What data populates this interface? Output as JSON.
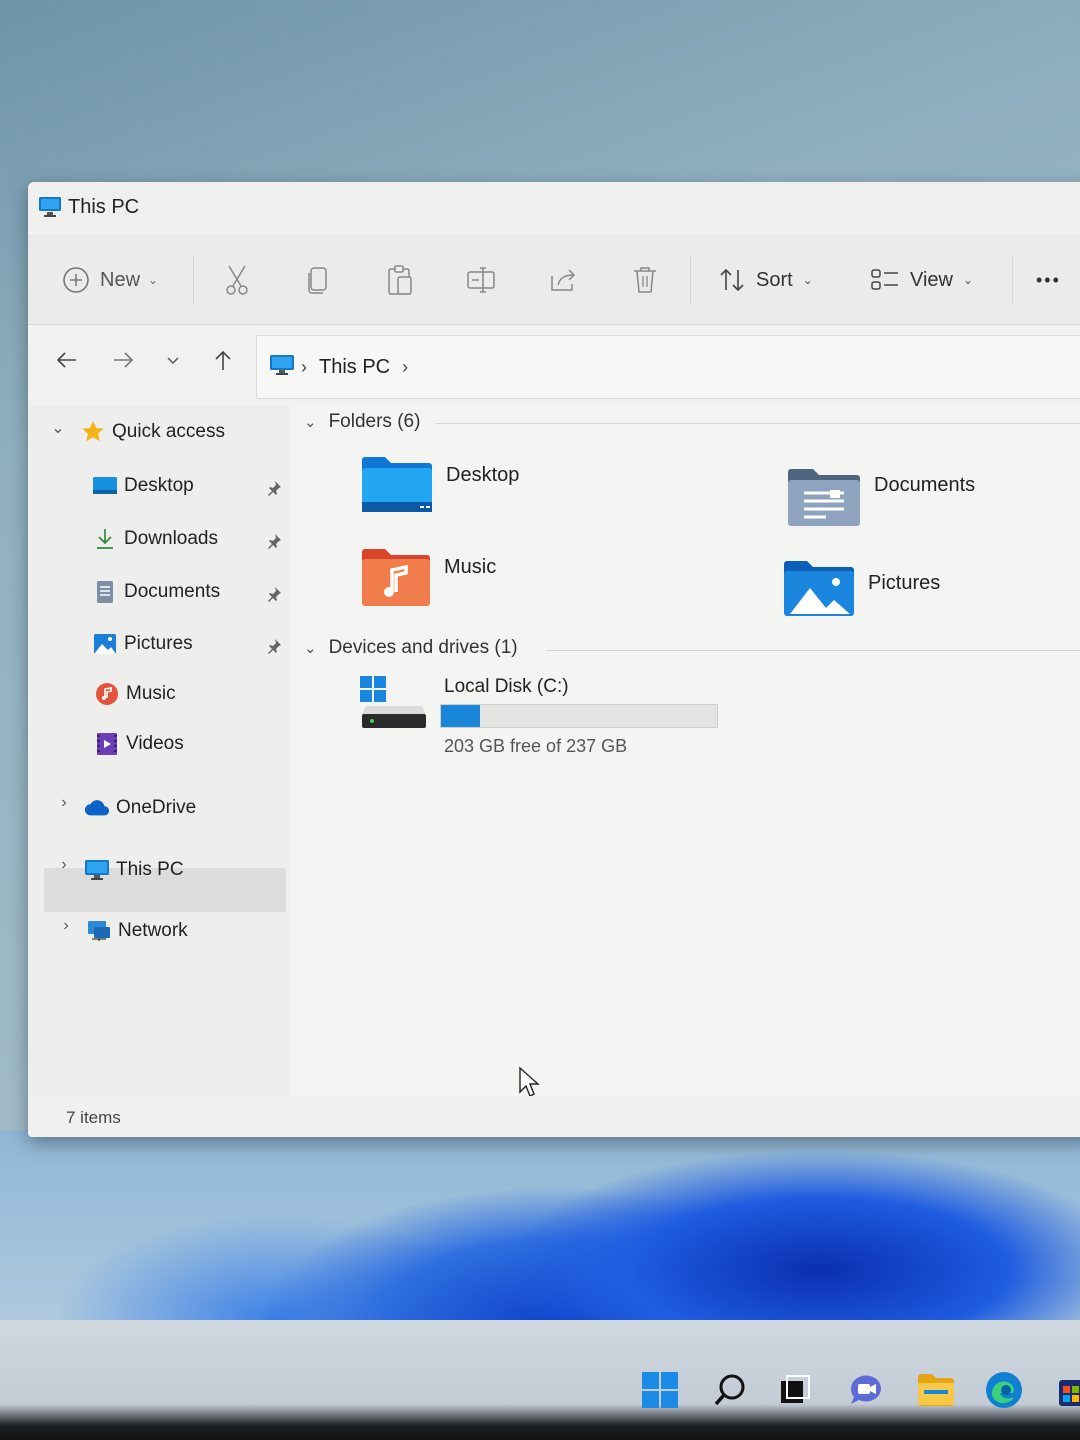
{
  "window": {
    "title": "This PC"
  },
  "toolbar": {
    "new_label": "New",
    "sort_label": "Sort",
    "view_label": "View",
    "more_label": "•••"
  },
  "address": {
    "location": "This PC"
  },
  "sidebar": {
    "quick_access": "Quick access",
    "items": [
      {
        "label": "Desktop",
        "icon": "desktop-folder-icon",
        "pinned": true
      },
      {
        "label": "Downloads",
        "icon": "downloads-icon",
        "pinned": true
      },
      {
        "label": "Documents",
        "icon": "documents-icon",
        "pinned": true
      },
      {
        "label": "Pictures",
        "icon": "pictures-icon",
        "pinned": true
      },
      {
        "label": "Music",
        "icon": "music-icon",
        "pinned": false
      },
      {
        "label": "Videos",
        "icon": "videos-icon",
        "pinned": false
      }
    ],
    "onedrive": "OneDrive",
    "thispc": "This PC",
    "network": "Network"
  },
  "content": {
    "folders_header": "Folders (6)",
    "folders": [
      {
        "label": "Desktop"
      },
      {
        "label": "Documents"
      },
      {
        "label": "Music"
      },
      {
        "label": "Pictures"
      }
    ],
    "drives_header": "Devices and drives (1)",
    "drive": {
      "label": "Local Disk (C:)",
      "free_text": "203 GB free of 237 GB",
      "used_fraction": 0.143
    }
  },
  "status": {
    "items": "7 items"
  },
  "colors": {
    "accent": "#1a86d9",
    "selection": "#dcdcda"
  }
}
